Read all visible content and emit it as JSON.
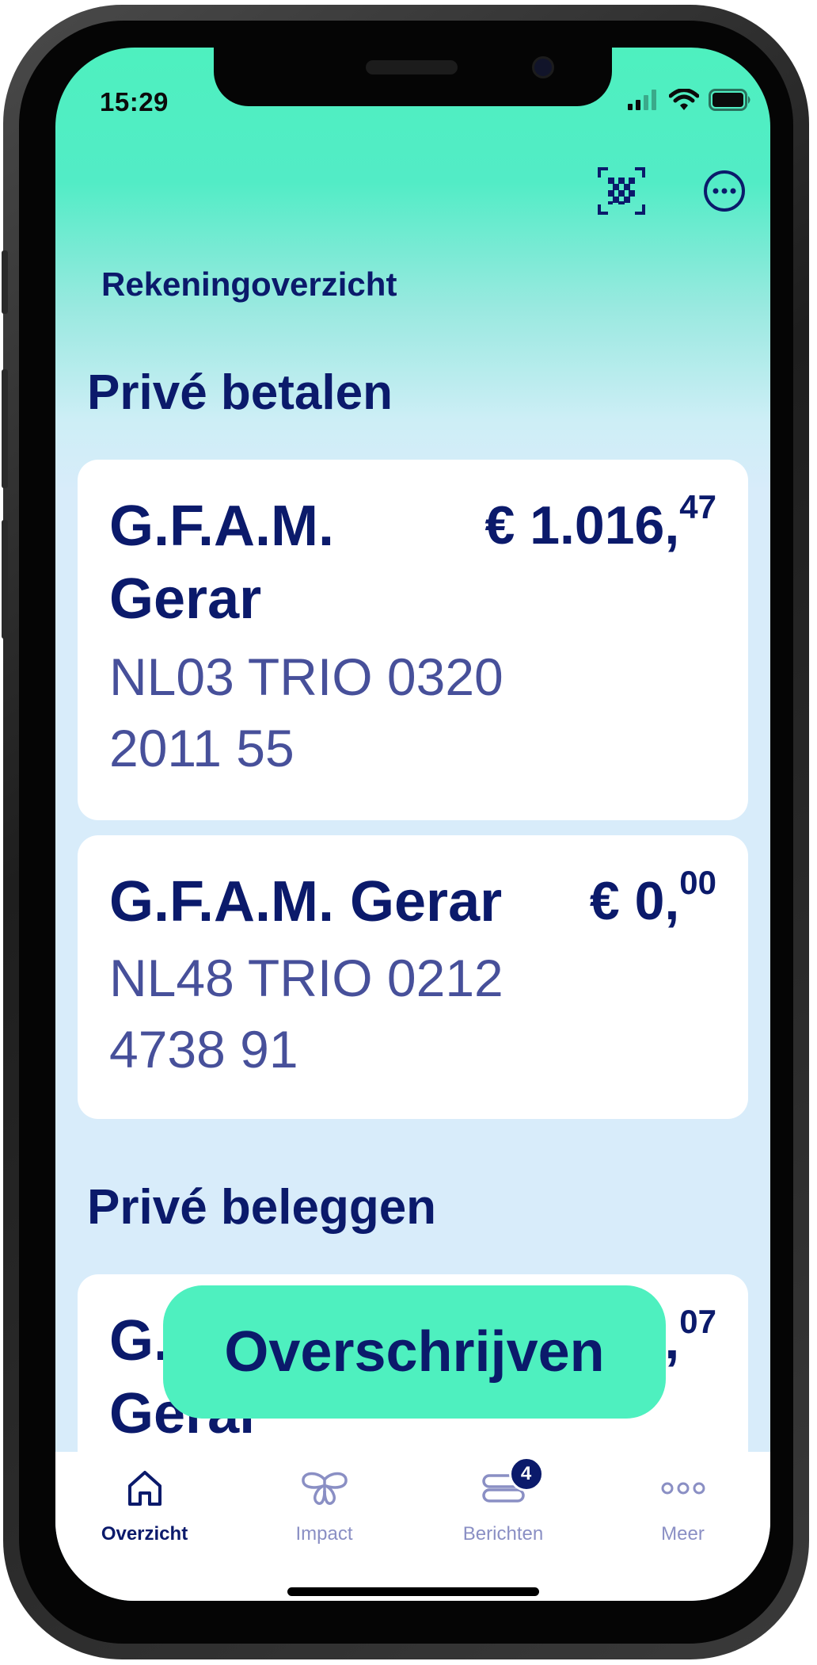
{
  "status_bar": {
    "time": "15:29"
  },
  "header": {
    "title": "Rekeningoverzicht"
  },
  "sections": [
    {
      "title": "Privé betalen"
    },
    {
      "title": "Privé beleggen"
    }
  ],
  "accounts": [
    {
      "name_line1": "G.F.A.M.",
      "name_line2": "Gerar",
      "amount_main": "€ 1.016,",
      "amount_cents": "47",
      "iban_line1": "NL03 TRIO 0320",
      "iban_line2": "2011 55"
    },
    {
      "name_line1": "G.F.A.M. Gerar",
      "amount_main": "€ 0,",
      "amount_cents": "00",
      "iban_line1": "NL48 TRIO 0212",
      "iban_line2": "4738 91"
    },
    {
      "name_line1": "G.",
      "name_line2": "Gerar",
      "amount_partial": ",",
      "amount_cents": "07"
    }
  ],
  "cta": {
    "label": "Overschrijven"
  },
  "tabs": [
    {
      "label": "Overzicht",
      "icon": "home-icon",
      "active": true
    },
    {
      "label": "Impact",
      "icon": "butterfly-icon"
    },
    {
      "label": "Berichten",
      "icon": "messages-icon",
      "badge": "4"
    },
    {
      "label": "Meer",
      "icon": "more-icon"
    }
  ],
  "colors": {
    "navy": "#0b1a6b",
    "mint": "#4ef0bf",
    "muted": "#8a8fc4"
  }
}
